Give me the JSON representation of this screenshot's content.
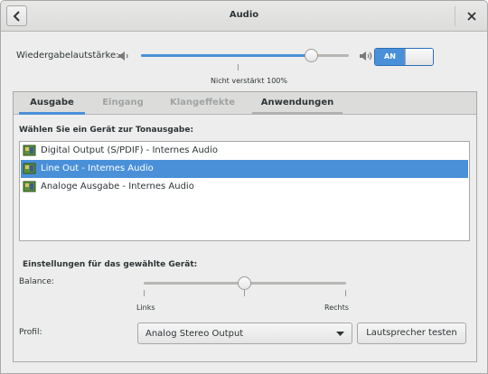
{
  "window": {
    "title": "Audio"
  },
  "header": {
    "back_icon": "chevron-left-icon",
    "close_icon": "close-icon"
  },
  "volume": {
    "label": "Wiedergabelautstärke:",
    "level": 0.82,
    "caption": "Nicht verstärkt 100%",
    "switch_label": "AN",
    "switch_state": "on",
    "low_icon": "speaker-low-icon",
    "high_icon": "speaker-high-icon"
  },
  "tabs": [
    {
      "label": "Ausgabe",
      "state": "active"
    },
    {
      "label": "Eingang",
      "state": "disabled"
    },
    {
      "label": "Klangeffekte",
      "state": "disabled"
    },
    {
      "label": "Anwendungen",
      "state": "normal"
    }
  ],
  "output": {
    "device_heading": "Wählen Sie ein Gerät zur Tonausgabe:",
    "devices": [
      {
        "label": "Digital Output (S/PDIF) - Internes Audio",
        "selected": false,
        "icon": "audio-card-icon"
      },
      {
        "label": "Line Out - Internes Audio",
        "selected": true,
        "icon": "audio-card-icon"
      },
      {
        "label": "Analoge Ausgabe - Internes Audio",
        "selected": false,
        "icon": "audio-card-icon"
      }
    ],
    "settings_heading": "Einstellungen für das gewählte Gerät:",
    "balance": {
      "label": "Balance:",
      "value": 0.5,
      "left_label": "Links",
      "right_label": "Rechts"
    },
    "profile": {
      "label": "Profil:",
      "selected": "Analog Stereo Output"
    },
    "test_button": "Lautsprecher testen"
  },
  "colors": {
    "accent": "#4a90d9",
    "window_bg": "#ededed",
    "list_bg": "#ffffff"
  }
}
